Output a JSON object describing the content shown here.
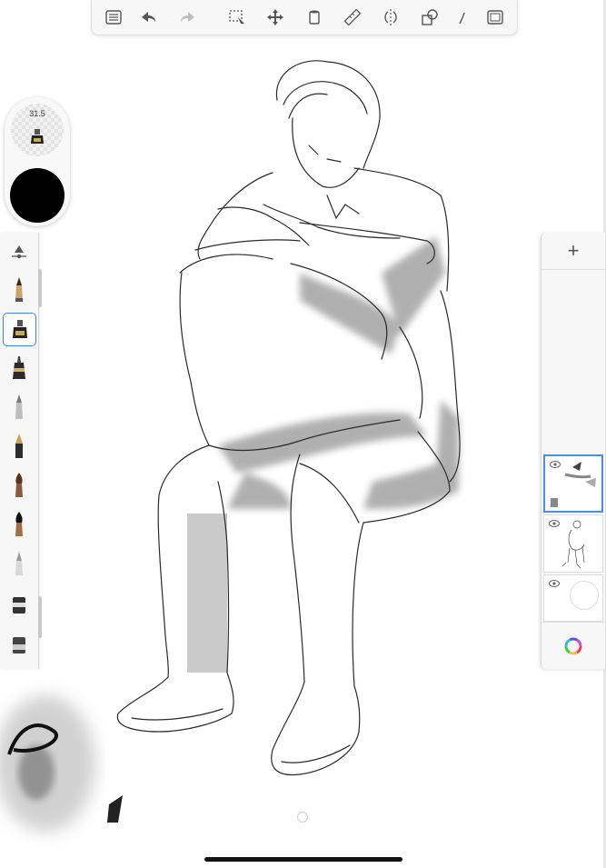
{
  "toolbar": {
    "items": [
      {
        "name": "layers-list-icon"
      },
      {
        "name": "undo-icon"
      },
      {
        "name": "redo-icon"
      },
      {
        "name": "selection-icon"
      },
      {
        "name": "transform-icon"
      },
      {
        "name": "fill-bucket-icon"
      },
      {
        "name": "ruler-icon"
      },
      {
        "name": "symmetry-icon"
      },
      {
        "name": "shapes-icon"
      },
      {
        "name": "perspective-icon"
      },
      {
        "name": "fullscreen-icon"
      }
    ]
  },
  "brush_puck": {
    "size_value": "31.5",
    "color": "#000000",
    "brush_icon": "inking-pen-icon"
  },
  "brush_palette": {
    "items": [
      {
        "name": "brush-settings-icon",
        "selected": false
      },
      {
        "name": "pencil-brush-icon",
        "selected": false
      },
      {
        "name": "inking-pen-icon",
        "selected": true
      },
      {
        "name": "technical-pen-icon",
        "selected": false
      },
      {
        "name": "ballpoint-pen-icon",
        "selected": false
      },
      {
        "name": "fountain-pen-icon",
        "selected": false
      },
      {
        "name": "paintbrush-icon",
        "selected": false
      },
      {
        "name": "marker-icon",
        "selected": false
      },
      {
        "name": "airbrush-icon",
        "selected": false
      },
      {
        "name": "eraser-icon",
        "selected": false
      },
      {
        "name": "smudge-icon",
        "selected": false
      }
    ]
  },
  "layers_panel": {
    "add_label": "+",
    "layers": [
      {
        "name": "layer-shading",
        "visible": true,
        "active": true
      },
      {
        "name": "layer-linework",
        "visible": true,
        "active": false
      },
      {
        "name": "layer-background",
        "visible": true,
        "active": false
      }
    ],
    "color_wheel": "color-wheel-icon"
  },
  "colors": {
    "accent": "#3a86e0",
    "toolbar_bg": "#f7f7f7",
    "ink": "#000000"
  }
}
